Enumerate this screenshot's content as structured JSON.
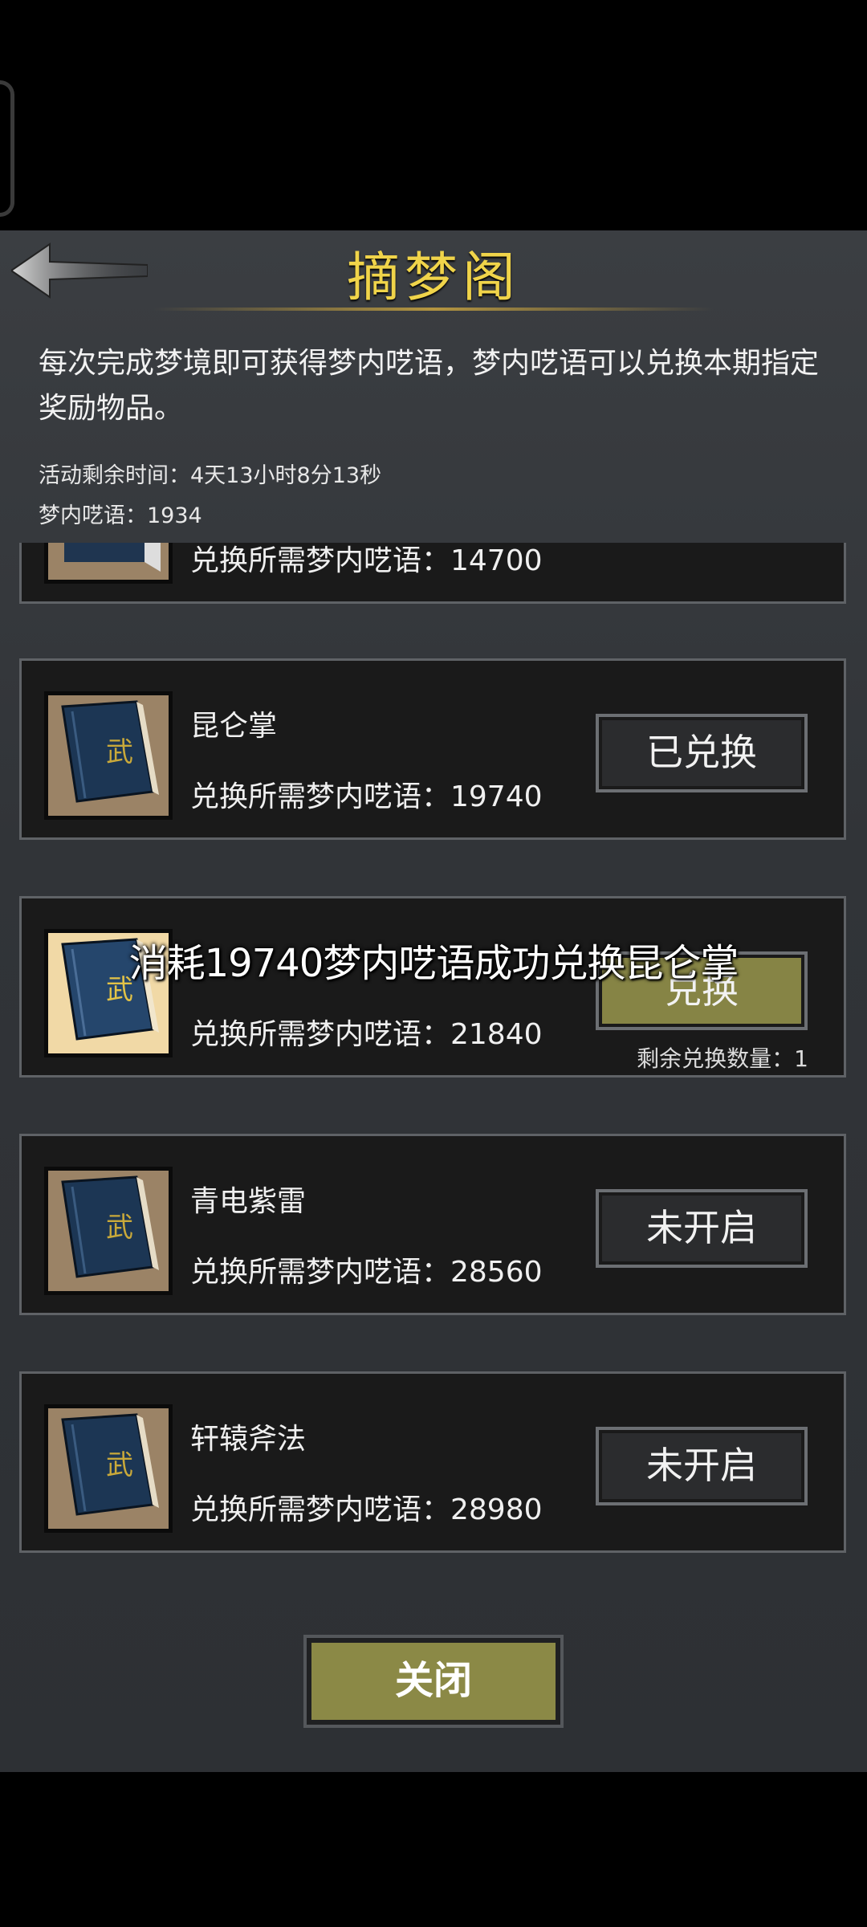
{
  "header": {
    "title": "摘梦阁",
    "description": "每次完成梦境即可获得梦内呓语，梦内呓语可以兑换本期指定奖励物品。",
    "time_remaining": "活动剩余时间：4天13小时8分13秒",
    "currency": "梦内呓语：1934"
  },
  "items": [
    {
      "name": "",
      "cost": "兑换所需梦内呓语：14700",
      "button": "",
      "icon": "martial-book-icon"
    },
    {
      "name": "昆仑掌",
      "cost": "兑换所需梦内呓语：19740",
      "button": "已兑换",
      "icon": "martial-book-icon"
    },
    {
      "name": "",
      "cost": "兑换所需梦内呓语：21840",
      "button": "兑换",
      "remaining": "剩余兑换数量：1",
      "icon": "martial-book-icon"
    },
    {
      "name": "青电紫雷",
      "cost": "兑换所需梦内呓语：28560",
      "button": "未开启",
      "icon": "martial-book-icon"
    },
    {
      "name": "轩辕斧法",
      "cost": "兑换所需梦内呓语：28980",
      "button": "未开启",
      "icon": "martial-book-icon"
    }
  ],
  "toast": "消耗19740梦内呓语成功兑换昆仑掌",
  "footer": {
    "close_label": "关闭"
  },
  "colors": {
    "title": "#f0d44a",
    "active_button": "#868445",
    "card_bg": "#1a1a1a"
  }
}
